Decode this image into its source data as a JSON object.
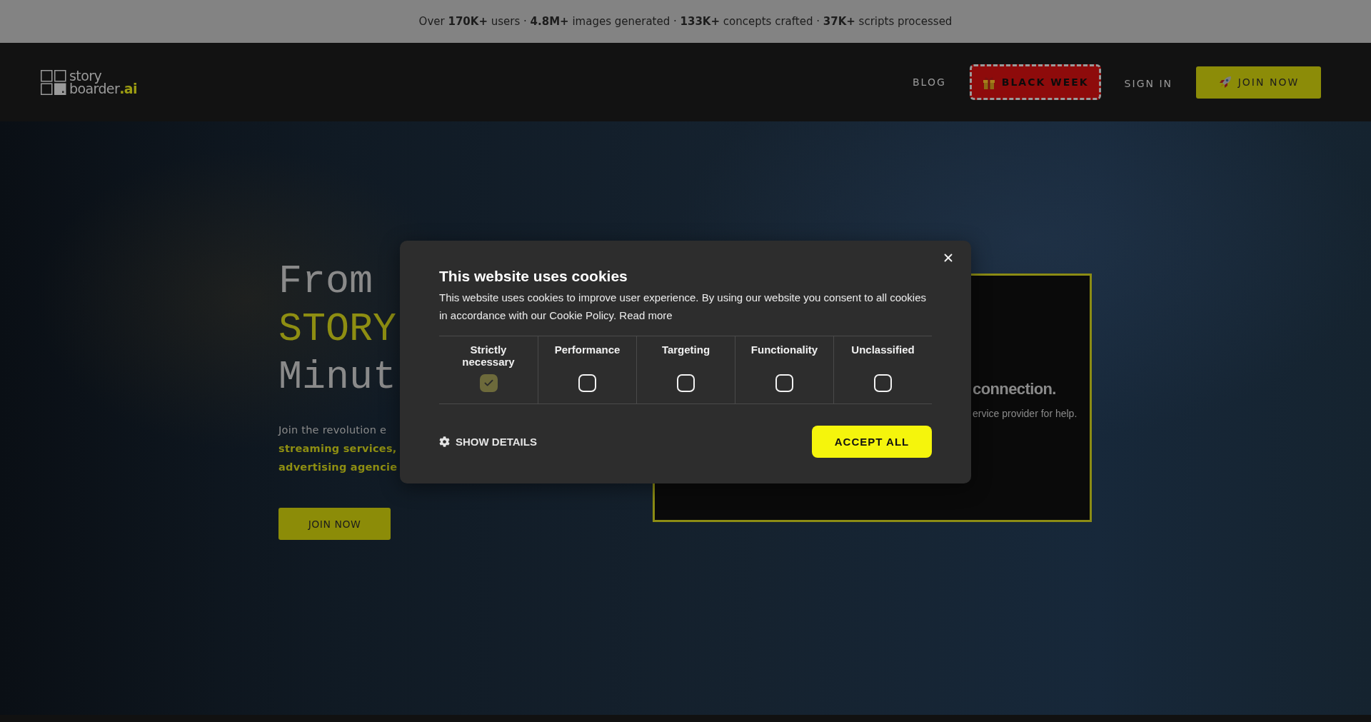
{
  "banner": {
    "text": "Over **170K+** users · **4.8M+** images generated · **133K+** concepts crafted · **37K+** scripts processed"
  },
  "header": {
    "logo": [
      "story",
      "boarder**.ai**"
    ],
    "nav": [
      {
        "kind": "link",
        "label": "BLOG"
      },
      {
        "kind": "promo",
        "label": "BLACK WEEK"
      },
      {
        "kind": "link",
        "label": "SIGN IN"
      },
      {
        "kind": "cta",
        "label": "JOIN NOW"
      }
    ]
  },
  "hero": {
    "title": [
      {
        "text": "From",
        "highlight": false
      },
      {
        "text": "STORY",
        "highlight": true
      },
      {
        "text": "Minut",
        "highlight": false
      }
    ],
    "description": [
      "Join the revolution e",
      "**streaming services,**",
      "**advertising agencie**"
    ],
    "button": "JOIN NOW"
  },
  "video_panel": {
    "heading": "connection.",
    "message": "ervice provider for help."
  },
  "cookie_dialog": {
    "title": "This website uses cookies",
    "text": "This website uses cookies to improve user experience. By using our website you consent to all cookies in accordance with our Cookie Policy.",
    "link": "Read more",
    "categories": [
      {
        "label": "Strictly necessary",
        "checked": true
      },
      {
        "label": "Performance",
        "checked": false
      },
      {
        "label": "Targeting",
        "checked": false
      },
      {
        "label": "Functionality",
        "checked": false
      },
      {
        "label": "Unclassified",
        "checked": false
      }
    ],
    "details_button": "SHOW DETAILS",
    "accept_button": "ACCEPT ALL"
  }
}
